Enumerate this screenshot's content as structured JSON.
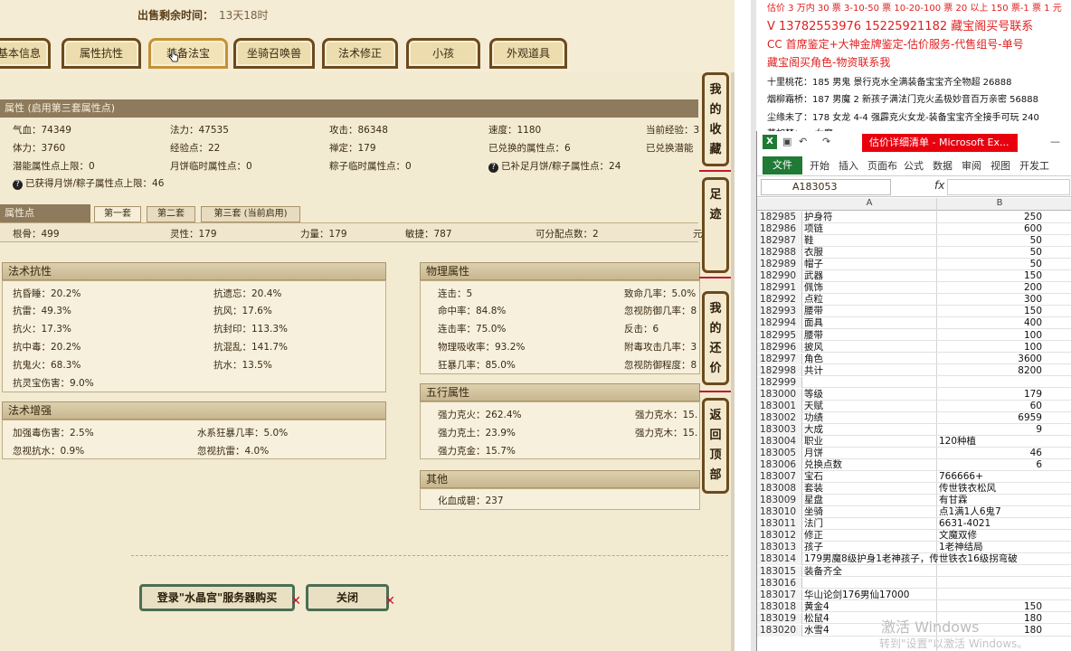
{
  "game": {
    "sale_label": "出售剩余时间：",
    "sale_value": "13天18时",
    "tabs": [
      "基本信息",
      "属性抗性",
      "装备法宝",
      "坐骑召唤兽",
      "法术修正",
      "小孩",
      "外观道具"
    ],
    "attr_section_title": "属性 (启用第三套属性点)",
    "attr_rows": [
      [
        "气血：74349",
        "法力：47535",
        "攻击：86348",
        "速度：1180",
        "当前经验：3"
      ],
      [
        "体力：3760",
        "经验点：22",
        "禅定：179",
        "已兑换的属性点：6",
        "已兑换潜能"
      ],
      [
        "潜能属性点上限：0",
        "月饼临时属性点：0",
        "粽子临时属性点：0",
        "已补足月饼/粽子属性点：24",
        ""
      ]
    ],
    "attr_extra": "已获得月饼/粽子属性点上限：46",
    "points_section_title": "属性点",
    "subtabs": [
      "第一套",
      "第二套",
      "第三套 (当前启用)"
    ],
    "points_row": [
      "根骨：499",
      "灵性：179",
      "力量：179",
      "敏捷：787",
      "可分配点数：2",
      "元"
    ],
    "resist": {
      "title": "法术抗性",
      "rows": [
        [
          "抗昏睡：20.2%",
          "抗遗忘：20.4%"
        ],
        [
          "抗雷：49.3%",
          "抗风：17.6%"
        ],
        [
          "抗火：17.3%",
          "抗封印：113.3%"
        ],
        [
          "抗中毒：20.2%",
          "抗混乱：141.7%"
        ],
        [
          "抗鬼火：68.3%",
          "抗水：13.5%"
        ],
        [
          "抗灵宝伤害：9.0%",
          ""
        ]
      ]
    },
    "enhance": {
      "title": "法术增强",
      "rows": [
        [
          "加强毒伤害：2.5%",
          "水系狂暴几率：5.0%"
        ],
        [
          "忽视抗水：0.9%",
          "忽视抗雷：4.0%"
        ]
      ]
    },
    "physical": {
      "title": "物理属性",
      "rows": [
        [
          "连击：5",
          "致命几率：5.0%"
        ],
        [
          "命中率：84.8%",
          "忽视防御几率：8"
        ],
        [
          "连击率：75.0%",
          "反击：6"
        ],
        [
          "物理吸收率：93.2%",
          "附毒攻击几率：3"
        ],
        [
          "狂暴几率：85.0%",
          "忽视防御程度：8"
        ]
      ]
    },
    "five": {
      "title": "五行属性",
      "rows": [
        [
          "强力克火：262.4%",
          "强力克水：15."
        ],
        [
          "强力克土：23.9%",
          "强力克木：15."
        ],
        [
          "强力克金：15.7%",
          ""
        ]
      ]
    },
    "other": {
      "title": "其他",
      "rows": [
        [
          "化血成碧：237"
        ]
      ]
    },
    "side_buttons": [
      "我的收藏",
      "足迹",
      "我的还价",
      "返回顶部"
    ],
    "buy_button": "登录\"水晶宫\"服务器购买",
    "close_button": "关闭"
  },
  "notes": {
    "lines": [
      {
        "text": "估价 3 万内 30 票  3-10-50 票  10-20-100 票  20 以上 150 票-1 票 1 元",
        "color": "red"
      },
      {
        "text": "V 13782553976    15225921182   藏宝阁买号联系",
        "color": "red"
      },
      {
        "text": "CC 首席鉴定+大神金牌鉴定-估价服务-代售组号-单号",
        "color": "red"
      },
      {
        "text": "藏宝阁买角色-物资联系我",
        "color": "red"
      },
      {
        "text": "十里桃花：185 男鬼 景行克水全满装备宝宝齐全物超 26888",
        "color": "black"
      },
      {
        "text": "烟柳霜桥：187 男魔 2 新孩子满法门克火孟极妙音百万亲密 56888",
        "color": "black"
      },
      {
        "text": "尘缘未了：178 女龙 4-4 强霹克火女龙-装备宝宝齐全接手可玩 240",
        "color": "black"
      },
      {
        "text": "莫如梦：... 女魔 ...",
        "color": "black"
      }
    ]
  },
  "excel": {
    "title": "估价详细清单 - Microsoft Ex...",
    "menus": [
      "开始",
      "插入",
      "页面布",
      "公式",
      "数据",
      "审阅",
      "视图",
      "开发工"
    ],
    "file_tab": "文件",
    "name_box": "A183053",
    "fx": "fx",
    "col_headers": [
      "A",
      "B"
    ],
    "rows": [
      [
        "182985",
        "护身符",
        "250"
      ],
      [
        "182986",
        "项链",
        "600"
      ],
      [
        "182987",
        "鞋",
        "50"
      ],
      [
        "182988",
        "衣服",
        "50"
      ],
      [
        "182989",
        "帽子",
        "50"
      ],
      [
        "182990",
        "武器",
        "150"
      ],
      [
        "182991",
        "佩饰",
        "200"
      ],
      [
        "182992",
        "点粒",
        "300"
      ],
      [
        "182993",
        "腰带",
        "150"
      ],
      [
        "182994",
        "面具",
        "400"
      ],
      [
        "182995",
        "腰带",
        "100"
      ],
      [
        "182996",
        "披风",
        "100"
      ],
      [
        "182997",
        "角色",
        "3600"
      ],
      [
        "182998",
        "共计",
        "8200"
      ],
      [
        "182999",
        "",
        ""
      ],
      [
        "183000",
        "等级",
        "179"
      ],
      [
        "183001",
        "天赋",
        "60"
      ],
      [
        "183002",
        "功绩",
        "6959"
      ],
      [
        "183003",
        "大成",
        "9"
      ],
      [
        "183004",
        "职业",
        "120种植"
      ],
      [
        "183005",
        "月饼",
        "46"
      ],
      [
        "183006",
        "兑换点数",
        "6"
      ],
      [
        "183007",
        "宝石",
        "766666+"
      ],
      [
        "183008",
        "套装",
        "传世铁衣松风"
      ],
      [
        "183009",
        "星盘",
        "有甘霖"
      ],
      [
        "183010",
        "坐骑",
        "点1满1人6鬼7"
      ],
      [
        "183011",
        "法门",
        "6631-4021"
      ],
      [
        "183012",
        "修正",
        "文魔双修"
      ],
      [
        "183013",
        "孩子",
        "1老神结局"
      ],
      [
        "183014",
        "179男魔8级护身1老神孩子，传世铁衣16级拐弯破",
        ""
      ],
      [
        "183015",
        "装备齐全",
        ""
      ],
      [
        "183016",
        "",
        ""
      ],
      [
        "183017",
        "华山论剑176男仙17000",
        ""
      ],
      [
        "183018",
        "黄金4",
        "150"
      ],
      [
        "183019",
        "松鼠4",
        "180"
      ],
      [
        "183020",
        "水雪4",
        "180"
      ]
    ]
  },
  "watermark": {
    "line1": "激活 Windows",
    "line2": "转到\"设置\"以激活 Windows。"
  }
}
